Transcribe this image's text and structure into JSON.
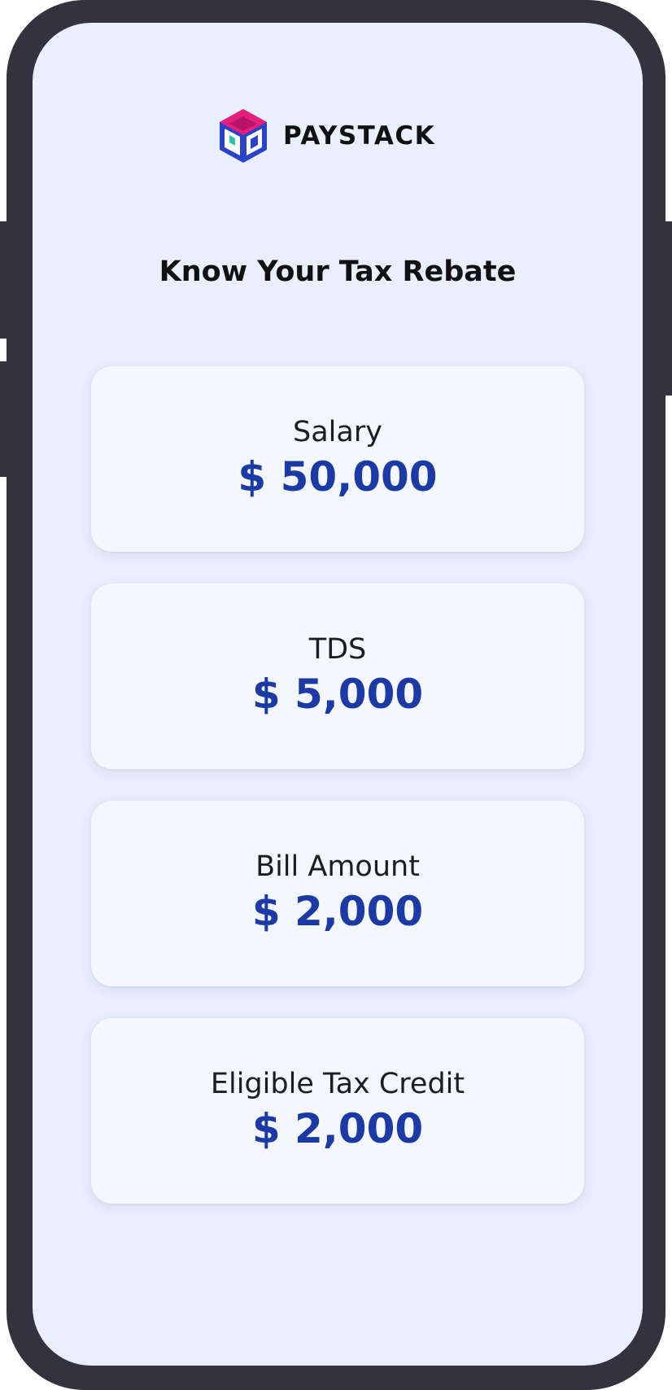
{
  "brand": {
    "name": "PAYSTACK",
    "logo_icon": "paystack-box-logo-icon"
  },
  "page": {
    "title": "Know Your Tax Rebate"
  },
  "cards": [
    {
      "label": "Salary",
      "value": "$ 50,000"
    },
    {
      "label": "TDS",
      "value": "$ 5,000"
    },
    {
      "label": "Bill Amount",
      "value": "$ 2,000"
    },
    {
      "label": "Eligible Tax Credit",
      "value": "$ 2,000"
    }
  ],
  "colors": {
    "frame": "#34323f",
    "screen_background": "#e9effd",
    "card_background": "#f4f7fe",
    "value_accent": "#1c3aa6",
    "text_dark": "#111114",
    "logo_blue": "#2a42c8",
    "logo_pink": "#e4207c"
  }
}
